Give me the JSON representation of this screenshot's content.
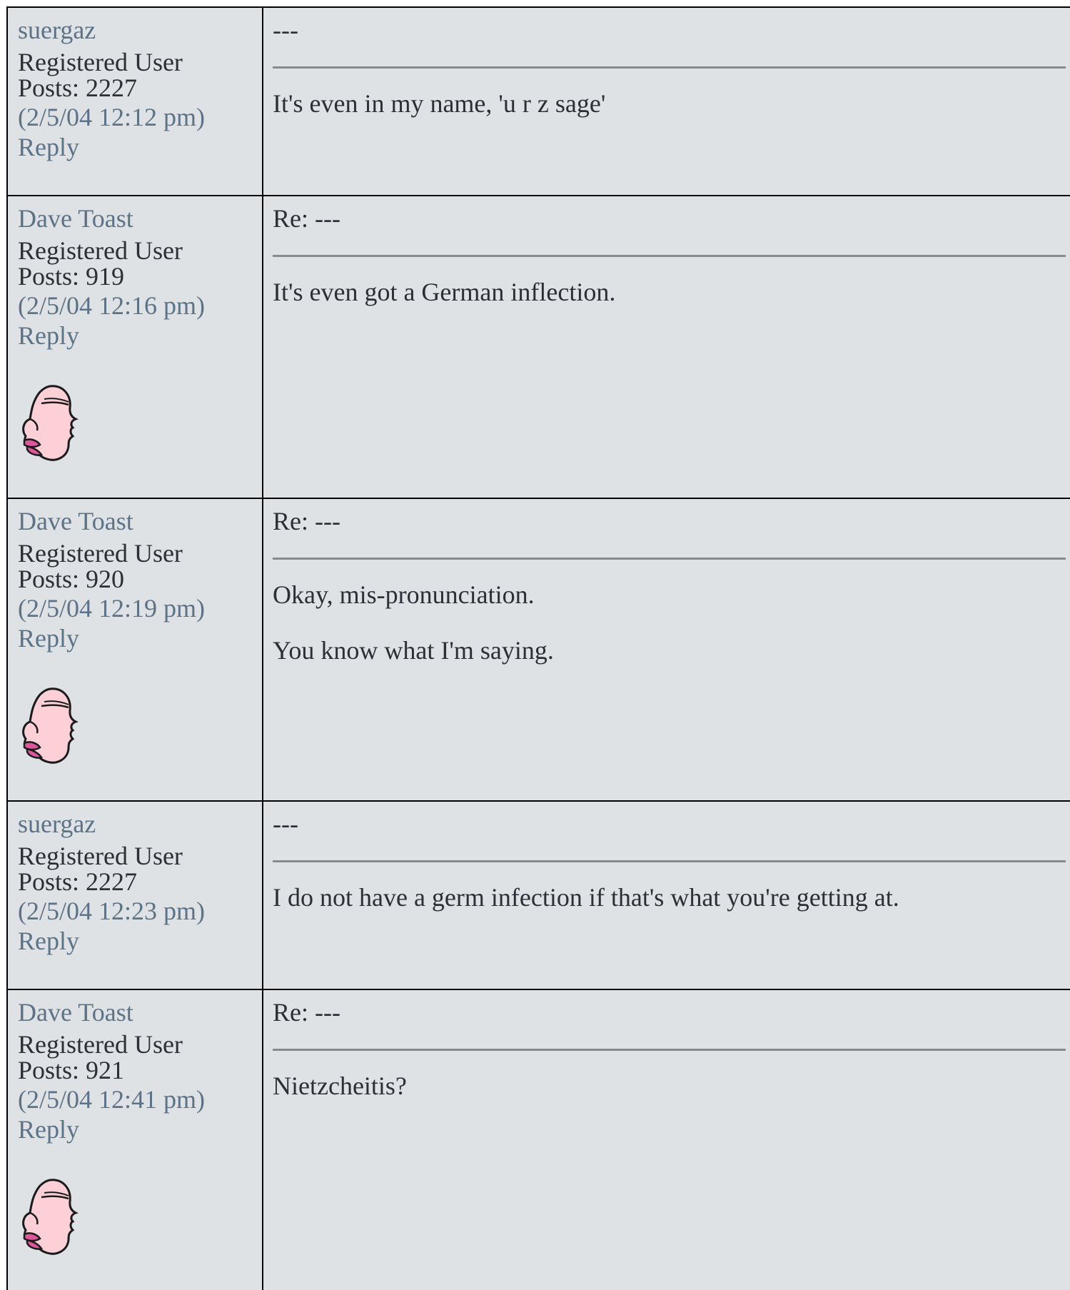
{
  "posts": [
    {
      "author": "suergaz",
      "role": "Registered User",
      "posts": "Posts: 2227",
      "time": "(2/5/04 12:12 pm)",
      "reply": "Reply",
      "subject": "---",
      "body": [
        "It's even in my name, 'u r z sage'"
      ],
      "avatar": ""
    },
    {
      "author": "Dave Toast",
      "role": "Registered User",
      "posts": "Posts: 919",
      "time": "(2/5/04 12:16 pm)",
      "reply": "Reply",
      "subject": "Re: ---",
      "body": [
        "It's even got a German inflection."
      ],
      "avatar": "cartoon-head-icon"
    },
    {
      "author": "Dave Toast",
      "role": "Registered User",
      "posts": "Posts: 920",
      "time": "(2/5/04 12:19 pm)",
      "reply": "Reply",
      "subject": "Re: ---",
      "body": [
        "Okay, mis-pronunciation.",
        "You know what I'm saying."
      ],
      "avatar": "cartoon-head-icon"
    },
    {
      "author": "suergaz",
      "role": "Registered User",
      "posts": "Posts: 2227",
      "time": "(2/5/04 12:23 pm)",
      "reply": "Reply",
      "subject": "---",
      "body": [
        "I do not have a germ infection if that's what you're getting at."
      ],
      "avatar": ""
    },
    {
      "author": "Dave Toast",
      "role": "Registered User",
      "posts": "Posts: 921",
      "time": "(2/5/04 12:41 pm)",
      "reply": "Reply",
      "subject": "Re: ---",
      "body": [
        "Nietzcheitis?"
      ],
      "avatar": "cartoon-head-icon"
    }
  ],
  "colors": {
    "background": "#dfe2e5",
    "link": "#5c7387",
    "text": "#2b2f36",
    "border": "#000000",
    "rule": "#8a8a8a"
  }
}
